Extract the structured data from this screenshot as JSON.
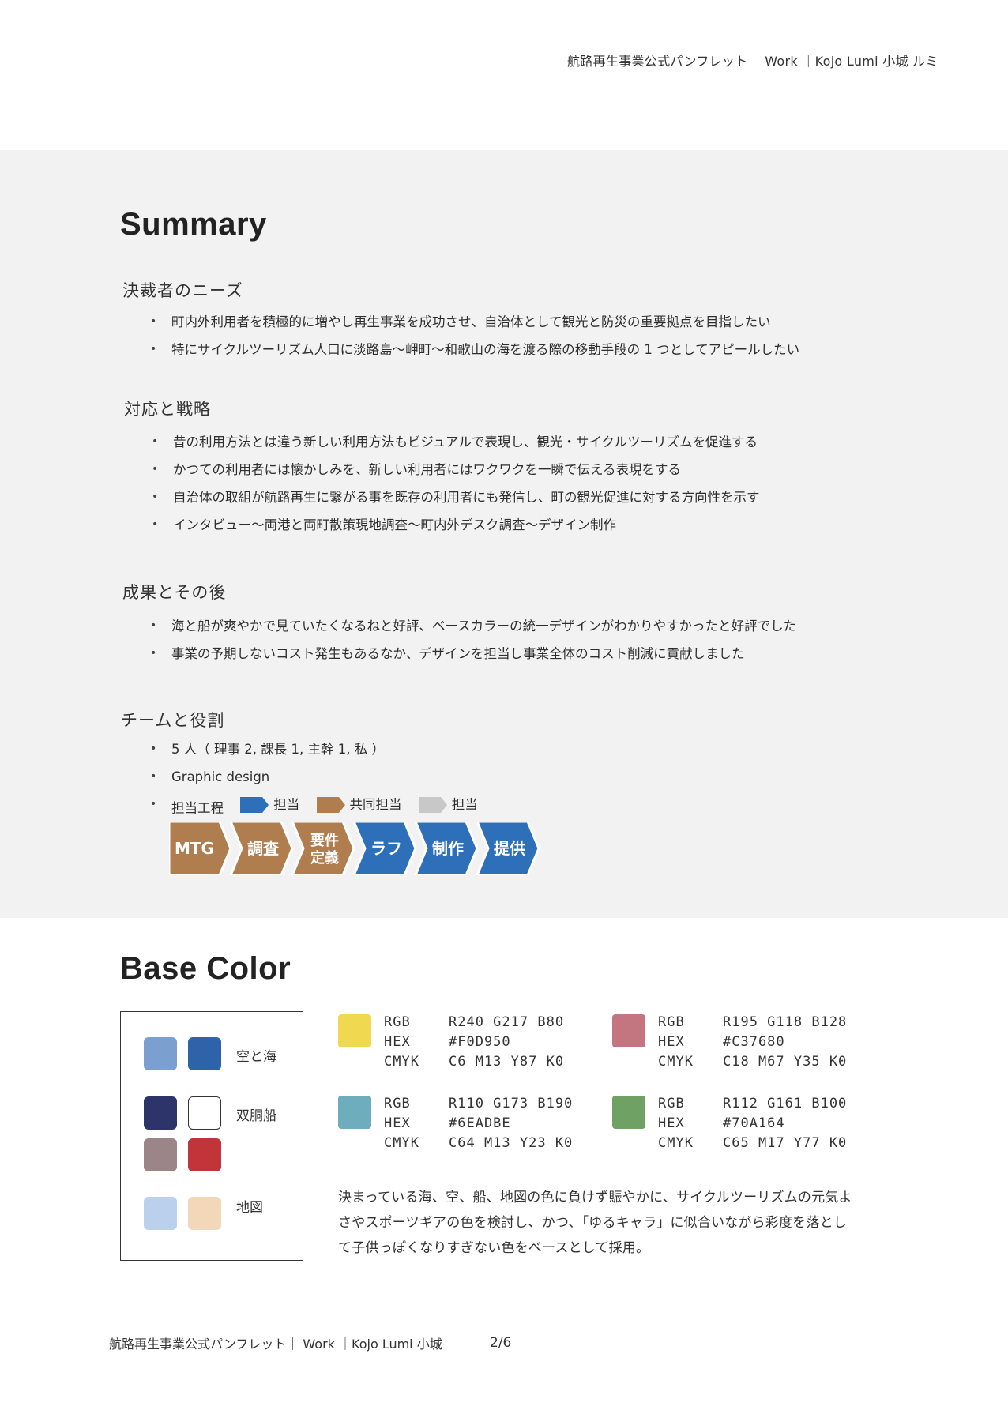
{
  "header": {
    "text": "航路再生事業公式パンフレット｜ Work ｜Kojo Lumi 小城 ルミ"
  },
  "summary": {
    "title": "Summary",
    "sections": [
      {
        "heading": "決裁者のニーズ",
        "items": [
          "町内外利用者を積極的に増やし再生事業を成功させ、自治体として観光と防災の重要拠点を目指したい",
          "特にサイクルツーリズム人口に淡路島〜岬町〜和歌山の海を渡る際の移動手段の 1 つとしてアピールしたい"
        ]
      },
      {
        "heading": "対応と戦略",
        "items": [
          "昔の利用方法とは違う新しい利用方法もビジュアルで表現し、観光・サイクルツーリズムを促進する",
          "かつての利用者には懐かしみを、新しい利用者にはワクワクを一瞬で伝える表現をする",
          "自治体の取組が航路再生に繋がる事を既存の利用者にも発信し、町の観光促進に対する方向性を示す",
          "インタビュー〜両港と両町散策現地調査〜町内外デスク調査〜デザイン制作"
        ]
      },
      {
        "heading": "成果とその後",
        "items": [
          "海と船が爽やかで見ていたくなるねと好評、ベースカラーの統一デザインがわかりやすかったと好評でした",
          "事業の予期しないコスト発生もあるなか、デザインを担当し事業全体のコスト削減に貢献しました"
        ]
      },
      {
        "heading": "チームと役割",
        "items": [
          "5 人（ 理事 2, 課長 1, 主幹 1, 私 ）",
          "Graphic design"
        ],
        "process_label": "担当工程",
        "legend": [
          {
            "label": "担当",
            "color": "#2e6fba"
          },
          {
            "label": "共同担当",
            "color": "#b07d4f"
          },
          {
            "label": "担当",
            "color": "#c8c8c8"
          }
        ],
        "process_steps": [
          {
            "label": "MTG",
            "color": "#b07d4f"
          },
          {
            "label": "調査",
            "color": "#b07d4f"
          },
          {
            "label": "要件\n定義",
            "color": "#b07d4f"
          },
          {
            "label": "ラフ",
            "color": "#2e6fba"
          },
          {
            "label": "制作",
            "color": "#2e6fba"
          },
          {
            "label": "提供",
            "color": "#2e6fba"
          }
        ]
      }
    ]
  },
  "base_color": {
    "title": "Base Color",
    "palette_groups": [
      {
        "label": "空と海",
        "swatches": [
          "#7b9fce",
          "#2f63a9"
        ]
      },
      {
        "label": "双胴船",
        "swatches": [
          "#2d3469",
          "#ffffff"
        ]
      },
      {
        "label": "",
        "swatches": [
          "#9b8589",
          "#c0343a"
        ]
      },
      {
        "label": "地図",
        "swatches": [
          "#bad0ec",
          "#f2d8b8"
        ]
      }
    ],
    "colors": [
      {
        "swatch": "#F0D950",
        "rgb": "R240 G217 B80",
        "hex": "#F0D950",
        "cmyk": "C6 M13 Y87 K0"
      },
      {
        "swatch": "#C37680",
        "rgb": "R195 G118 B128",
        "hex": "#C37680",
        "cmyk": "C18 M67 Y35 K0"
      },
      {
        "swatch": "#6EADBE",
        "rgb": "R110 G173 B190",
        "hex": "#6EADBE",
        "cmyk": "C64 M13 Y23 K0"
      },
      {
        "swatch": "#70A164",
        "rgb": "R112 G161 B100",
        "hex": "#70A164",
        "cmyk": "C65 M17 Y77 K0"
      }
    ],
    "row_labels": {
      "rgb": "RGB",
      "hex": "HEX",
      "cmyk": "CMYK"
    },
    "description": "決まっている海、空、船、地図の色に負けず賑やかに、サイクルツーリズムの元気よさやスポーツギアの色を検討し、かつ、「ゆるキャラ」に似合いながら彩度を落として子供っぽくなりすぎない色をベースとして採用。"
  },
  "footer": {
    "text": "航路再生事業公式パンフレット｜ Work ｜Kojo Lumi 小城",
    "page": "2/6"
  }
}
